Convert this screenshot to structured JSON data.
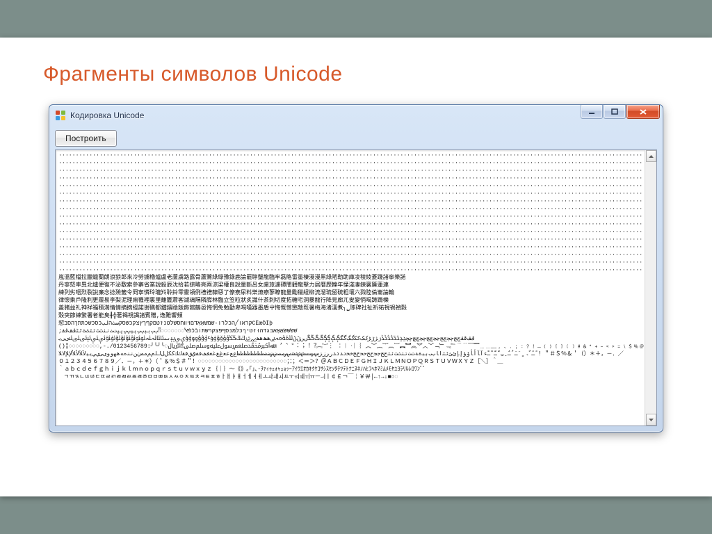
{
  "slide": {
    "title": "Фрагменты символов Unicode"
  },
  "window": {
    "title": "Кодировка Unicode",
    "buttons": {
      "build": "Построить"
    }
  },
  "content": {
    "dot_line": "································································································································································································································································",
    "cjk_line1": "嵐溫藍檔拉臘蠟蘭朗浪狼郎來冷勞擄櫓爐盧老蘆虜路露骨蘆鷺綠綠豫錄鹿論罷聤壟龍臨牢磊賂雷墨棲漫漫黑綠陋勒助庫凌稜綾菱踐諸寧樂諾",
    "cjk_line2": "丹寧怒率異北爐便復不泌敷索參寨省業說殺辰沈拾若掠略亮兩涼梁權良說量斷呂女慮旅濾磹闇髒龍擊力居曆歷轢年慄淺凄鍊襄簾蓮連",
    "cjk_line3": "練列劣咽烈裂說廉念捻殮籤令冏寧憐玲瓏羚聆鈴零靈領例禮禮隸惡了僚寮尿料樂燎療蓼瞭龍量勵獵紐柳流溜琉留硫粗壤六戮陸倫崙論輪",
    "cjk_line4": "律懷乘戶隆利更履易李梨泥理痢罹裡裏里離匵蕭客湖璃隔隣膵林臨立笠粒狀炙識什茶刺切度拓糖宅洞暴龍行降見廊兀叟變怲喝踌蹐櫟",
    "cjk_line5": "盖猪益礼神祥福積満情情摘摘經諾谢礁都鐺鑄蹌飯飾館鶴邑悔惘免勉勤卑喝嘆器墨盾屮悔慨憎懲敵既暑梅海渚漢煮╮␣琢碑社祉祈祐視禍禎穀",
    "cjk_line6": "穀突節練繁署者能臭╂╬著褐視謁諸賓贈,逸難響頻",
    "mixed_line1": "恝קראו╱הכלרו-שמשאַאִדםױװחסשלטנזטםקףךץצקכשסקسثהلبכסכשכתתךהסבCÈæÒÍþ",
    "mixed_line2": ";שׁשׂשּׁשּׂאַאָאּבּגּדּהּוּזּטּיּךּכּלּמּנּסּףּפּצּקּרּשּתּוֹבֿכֿפֿﭏ◌◌◌◌◌◌◌ﭐﭑﭒﭓﭔﭕﭖﭗﭘﭙﭚﭛﭜﭝﭞﭟﭠﭡﭢﭣﭤﭥﭦﭧﭨﭩﭪﭫﭬﭭ",
    "mixed_line3": "ﭮﭯﭰﭱﭲﭳﭴﭵﭶﭷﭸﭹﭺﭻﭼﭽﭾﭿﮀﮁﮂﮃﮄﮅﮆﮇﮈﮉﮊﮋﮌﮍﮎﮏﮐﮑﮒﮓﮔﮕﮖﮗﮘﮙﮚﮛﮜﮝﮞﮟﮠﮡﮢﮣﮤﮥﮦﮧﮨﮩﮪﮫﮬﮭﮮﮯﮰﮱﯓﯔﯕﯖﯗﯘﯙﯚﯛﯜﯝﯞﯟﯠﯡﯢﯣﯤﯥﯦﯧﯨﯩﯪﯫﯬﯭﯮﯯﯰﯱﯲﯳﯴﯵﯶﯷﯸﯹﯺﯻﯼﯽﯾ",
    "mixed_line4": "()╏◌◌◌◌◌◌◌◌◌,-./0123456789:╯╰╯╰◌ﷲﷳﷴﷵﷶﷷﷸﷹﷺ﷼ ︐︑︒︓︔︕︖︗︘︙ ︰︱︲︳︴︵︶︷︸︹︺︻︼︽︾︿﹀﹁﹂﹃﹄﹉﹊﹋﹌﹍﹎﹏﹐﹑﹒﹔﹕﹖﹗﹘﹙﹚﹛﹜﹝﹞﹟﹠﹡﹢﹣﹤﹥﹦﹨﹩﹪﹫",
    "mixed_line5": "ﹰﹱﹲﹳﹴﹶﹷﹸﹹﹺﹻﹼﹽﹾﹿﺀﺁﺂﺃﺄﺅﺆﺇﺈﺉﺊﺋﺌﺍﺎﺏﺐﺑﺒﺓﺔﺕﺖﺗﺘﺙﺚﺛﺜﺝﺞﺟﺠﺡﺢﺣﺤﺥﺦﺧﺨﺩﺪﺫﺬﺭﺮﺯﺰﺱﺲﺳﺴﺵﺶﺷﺸﺹﺺﺻﺼﺽﺾﺿﻀﻁﻂﻃﻄﻅﻆﻇﻈﻉﻊﻋﻌﻍﻎﻏﻐﻑﻒﻓﻔﻕﻖﻗﻘﻙﻚﻛﻜﻝﻞﻟﻠﻡﻢﻣﻤﻥﻦﻧﻨﻩﻪﻫﻬﻭﻮﻯﻰﻱﻲﻳﻴﻵﻶﻷﻸﻹﻺﻻﻼ！＂＃＄％＆＇（）＊＋，－．／",
    "mixed_line6": "０１２３４５６７８９／．－，＋＊）（＇＆％＄＃＂！◌◌◌◌◌◌◌◌◌◌◌◌◌◌◌◌◌◌◌◌◌◌◌◌◌◌；：；＜＝＞？＠ＡＢＣＤＥＦＧＨＩＪＫＬＭＮＯＰＱＲＳＴＵＶＷＸＹＺ［＼］＾＿",
    "mixed_line7": "｀ａｂｃｄｅｆｇｈｉｊｋｌｍｎｏｐｑｒｓｔｕｖｗｘｙｚ｛｜｝～｟｠｡｢｣､･ｦｧｨｩｪｫｬｭｮｯｰｱｲｳｴｵｶｷｸｹｺｻｼｽｾｿﾀﾁﾂﾃﾄﾅﾆﾇﾈﾉﾊﾋﾌﾍﾎﾏﾐﾑﾒﾓﾔﾕﾖﾗﾘﾙﾚﾛﾜﾝﾞﾟ",
    "mixed_line8": "ﾠﾡﾢﾣﾤﾥﾦﾧﾨﾩﾪﾫﾬﾭﾮﾯﾰﾱﾲﾳﾴﾵﾶﾷﾸﾹﾺﾻﾼﾽﾾￂￃￄￅￆￇￊￋￌￍￎￏￒￓￔￕￖￗￚￛￜ￠￡￢￣￤￥￦│←↑→↓■○◌"
  }
}
